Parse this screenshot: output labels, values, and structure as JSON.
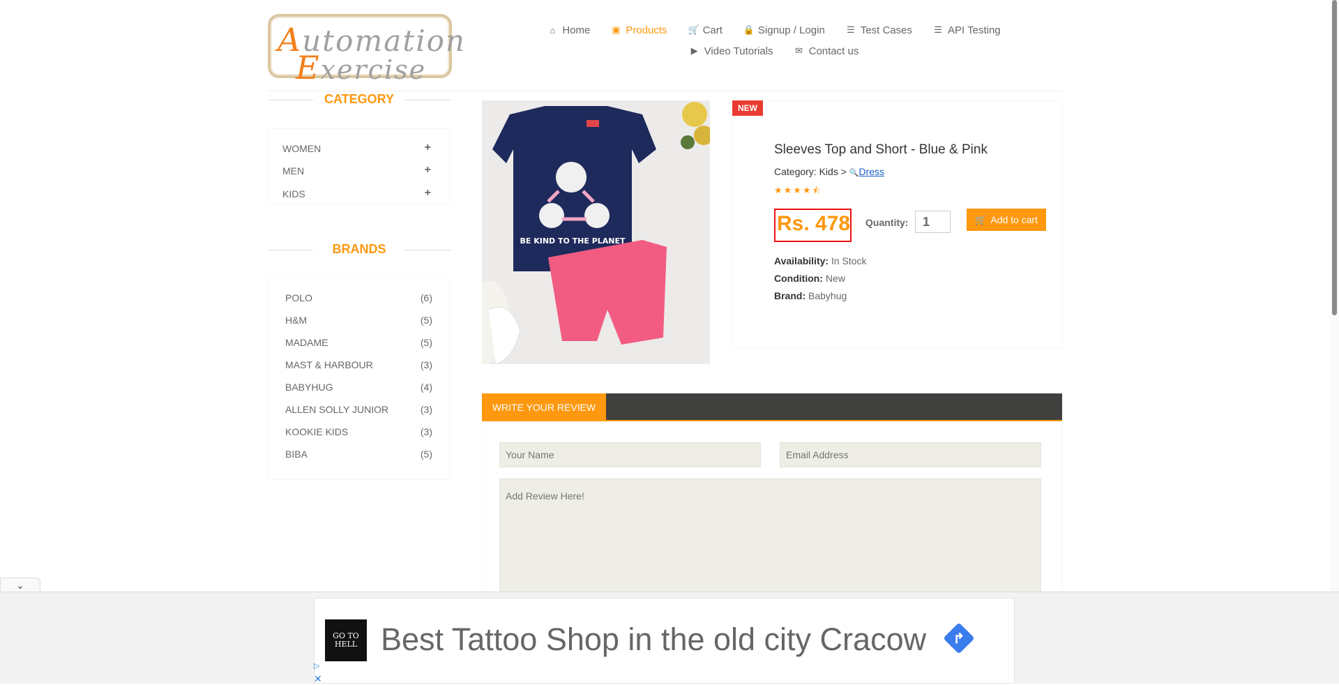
{
  "logo": {
    "line1_cap": "A",
    "line1_rest": "utomation",
    "line2_cap": "E",
    "line2_rest": "xercise"
  },
  "nav": {
    "row1": [
      {
        "icon": "home-icon",
        "glyph": "⌂",
        "label": "Home"
      },
      {
        "icon": "shop-icon",
        "glyph": "▣",
        "label": "Products",
        "active": true
      },
      {
        "icon": "cart-icon",
        "glyph": "🛒",
        "label": "Cart"
      },
      {
        "icon": "lock-icon",
        "glyph": "🔒",
        "label": "Signup / Login"
      },
      {
        "icon": "list-icon",
        "glyph": "☰",
        "label": "Test Cases"
      },
      {
        "icon": "list-icon",
        "glyph": "☰",
        "label": "API Testing"
      }
    ],
    "row2": [
      {
        "icon": "youtube-icon",
        "glyph": "▶",
        "label": "Video Tutorials"
      },
      {
        "icon": "envelope-icon",
        "glyph": "✉",
        "label": "Contact us"
      }
    ]
  },
  "sidebar": {
    "category_title": "CATEGORY",
    "categories": [
      "WOMEN",
      "MEN",
      "KIDS"
    ],
    "brands_title": "BRANDS",
    "brands": [
      {
        "name": "POLO",
        "count": "(6)"
      },
      {
        "name": "H&M",
        "count": "(5)"
      },
      {
        "name": "MADAME",
        "count": "(5)"
      },
      {
        "name": "MAST & HARBOUR",
        "count": "(3)"
      },
      {
        "name": "BABYHUG",
        "count": "(4)"
      },
      {
        "name": "ALLEN SOLLY JUNIOR",
        "count": "(3)"
      },
      {
        "name": "KOOKIE KIDS",
        "count": "(3)"
      },
      {
        "name": "BIBA",
        "count": "(5)"
      }
    ]
  },
  "product": {
    "badge": "NEW",
    "name": "Sleeves Top and Short - Blue & Pink",
    "category_prefix": "Category: Kids >",
    "category_link": "Dress",
    "stars": "★★★★⯪",
    "price": "Rs. 478",
    "quantity_label": "Quantity:",
    "quantity_value": "1",
    "add_to_cart": "Add to cart",
    "availability_label": "Availability:",
    "availability": "In Stock",
    "condition_label": "Condition:",
    "condition": "New",
    "brand_label": "Brand:",
    "brand": "Babyhug",
    "shirt_text": "BE KIND TO THE PLANET"
  },
  "review": {
    "tab": "WRITE YOUR REVIEW",
    "name_placeholder": "Your Name",
    "email_placeholder": "Email Address",
    "review_placeholder": "Add Review Here!"
  },
  "ad": {
    "text": "Best Tattoo Shop in the old city Cracow",
    "logo_text": "GO TO HELL"
  },
  "colors": {
    "accent": "#fe980f",
    "dark_bar": "#40403e",
    "badge_red": "#e93b30",
    "link": "#1a5fc5"
  }
}
